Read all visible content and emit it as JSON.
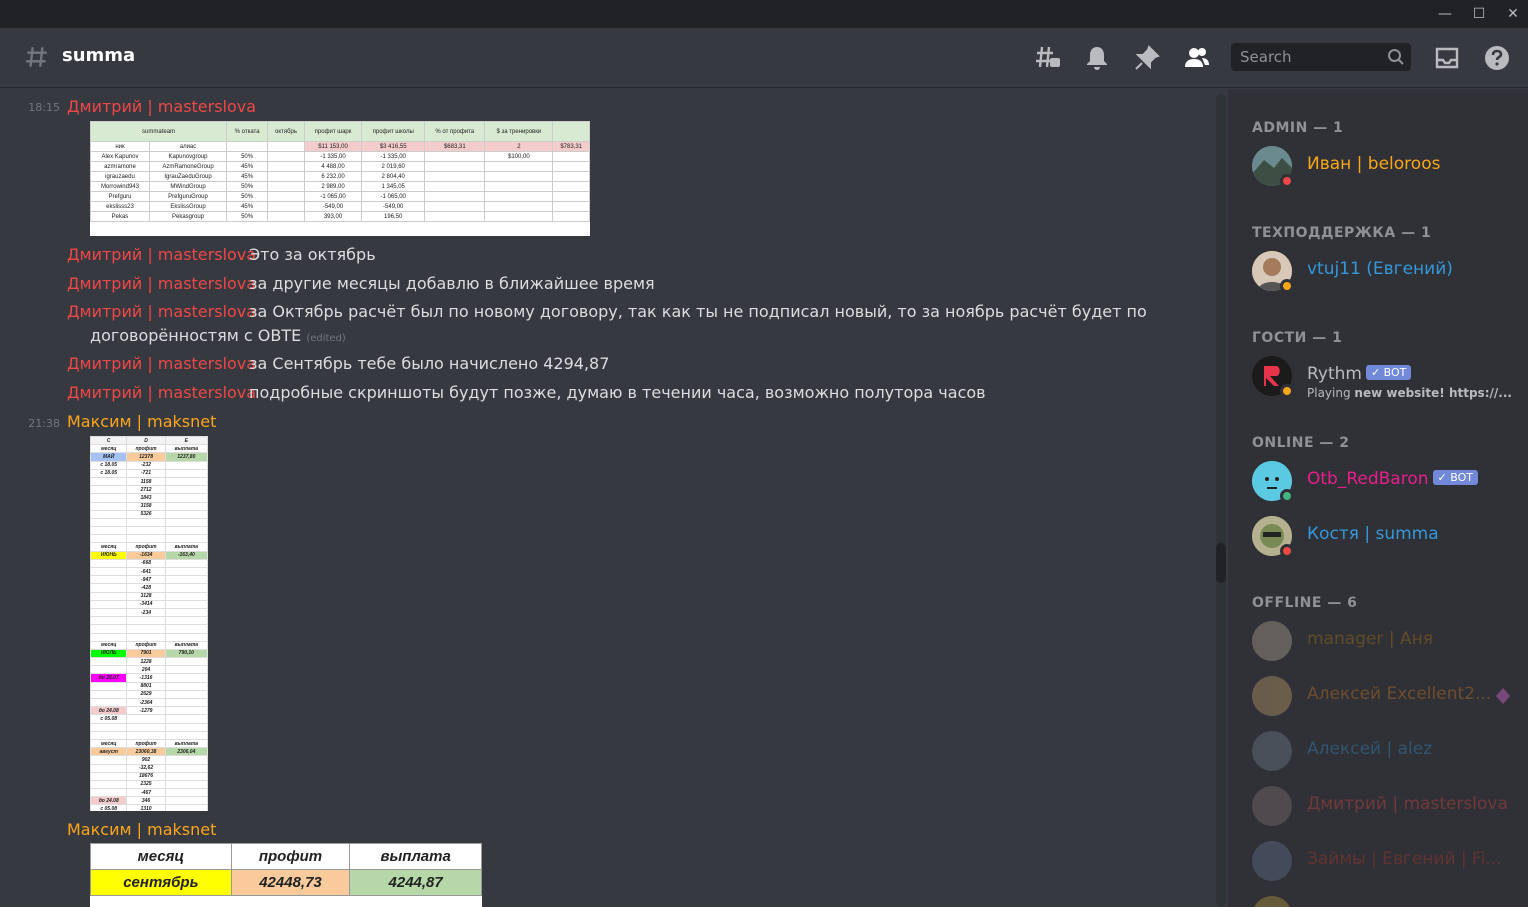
{
  "window": {
    "minimize": "—",
    "maximize": "☐",
    "close": "✕"
  },
  "channel": {
    "name": "summa"
  },
  "header": {
    "search_placeholder": "Search"
  },
  "messages": [
    {
      "time": "18:15",
      "author": "Дмитрий | masterslova"
    },
    {
      "author": "Дмитрий | masterslova",
      "text": "Это за октябрь"
    },
    {
      "author": "Дмитрий | masterslova",
      "text": "за другие месяцы добавлю  в ближайшее время"
    },
    {
      "author": "Дмитрий | masterslova",
      "text": "за Октябрь  расчёт был по новому договору, так как ты не подписал новый, то  за ноябрь расчёт будет по",
      "text2": "договорённостям с ОВТЕ",
      "edited": "(edited)"
    },
    {
      "author": "Дмитрий | masterslova",
      "text": "за Сентябрь тебе было начислено 4294,87"
    },
    {
      "author": "Дмитрий | masterslova",
      "text": "подробные скриншоты будут позже, думаю  в течении часа, возможно полутора часов"
    },
    {
      "time": "21:38",
      "author": "Максим | maksnet"
    },
    {
      "author": "Максим | maksnet"
    }
  ],
  "sheet1": {
    "header": [
      "summateam",
      "% отката",
      "октябрь",
      "профит шарк",
      "профит школы",
      "% от профита",
      "$ за тренировки",
      ""
    ],
    "sub": [
      "ник",
      "алиас",
      "",
      "",
      "$11 153,00",
      "$3 416,55",
      "$683,31",
      "2",
      "$783,31"
    ],
    "rows": [
      [
        "Alex Kapunov",
        "Kapunovgroup",
        "50%",
        "",
        "-1 335,00",
        "-1 335,00",
        "",
        "$100,00",
        ""
      ],
      [
        "azmramone",
        "AzmRamoneGroup",
        "45%",
        "",
        "4 488,00",
        "2 019,60",
        "",
        "",
        ""
      ],
      [
        "igrauzaedu",
        "IgrauZaeduGroup",
        "45%",
        "",
        "6 232,00",
        "2 804,40",
        "",
        "",
        ""
      ],
      [
        "Morrowind943",
        "MWindGroup",
        "50%",
        "",
        "2 989,00",
        "1 345,05",
        "",
        "",
        ""
      ],
      [
        "Prefguru",
        "PrefguruGroup",
        "50%",
        "",
        "-1 065,00",
        "-1 065,00",
        "",
        "",
        ""
      ],
      [
        "ekslisss23",
        "EkslissGroup",
        "45%",
        "",
        "-549,00",
        "-549,00",
        "",
        "",
        ""
      ],
      [
        "Pekas",
        "Pekasgroup",
        "50%",
        "",
        "393,00",
        "196,50",
        "",
        "",
        ""
      ]
    ]
  },
  "sheet2": {
    "rows": [
      [
        "C",
        "D",
        "E"
      ],
      [
        "месяц",
        "профит",
        "выплата"
      ],
      [
        "МАЙ",
        "12378",
        "1237,80"
      ],
      [
        "с 18.05",
        "-232",
        ""
      ],
      [
        "с 18.05",
        "-721",
        ""
      ],
      [
        "",
        "1158",
        ""
      ],
      [
        "",
        "2712",
        ""
      ],
      [
        "",
        "1843",
        ""
      ],
      [
        "",
        "3158",
        ""
      ],
      [
        "",
        "5326",
        ""
      ],
      [
        "",
        "",
        ""
      ],
      [
        "",
        "",
        ""
      ],
      [
        "",
        "",
        ""
      ],
      [
        "месяц",
        "профит",
        "выплата"
      ],
      [
        "ИЮНЬ",
        "-1634",
        "-163,40"
      ],
      [
        "",
        "-668",
        ""
      ],
      [
        "",
        "-641",
        ""
      ],
      [
        "",
        "-947",
        ""
      ],
      [
        "",
        "-428",
        ""
      ],
      [
        "",
        "3128",
        ""
      ],
      [
        "",
        "-3414",
        ""
      ],
      [
        "",
        "-234",
        ""
      ],
      [
        "",
        "",
        ""
      ],
      [
        "",
        "",
        ""
      ],
      [
        "",
        "",
        ""
      ],
      [
        "месяц",
        "профит",
        "выплата"
      ],
      [
        "ИЮЛЬ",
        "7901",
        "790,10"
      ],
      [
        "",
        "1228",
        ""
      ],
      [
        "",
        "204",
        ""
      ],
      [
        "до 26.07",
        "-1316",
        ""
      ],
      [
        "",
        "8801",
        ""
      ],
      [
        "",
        "2629",
        ""
      ],
      [
        "",
        "-2364",
        ""
      ],
      [
        "до 24.08",
        "-1279",
        ""
      ],
      [
        "с 05.08",
        "",
        ""
      ],
      [
        "",
        "",
        ""
      ],
      [
        "",
        "",
        ""
      ],
      [
        "месяц",
        "профит",
        "выплата"
      ],
      [
        "август",
        "23060,38",
        "2306,04"
      ],
      [
        "",
        "902",
        ""
      ],
      [
        "",
        "-32,62",
        ""
      ],
      [
        "",
        "18676",
        ""
      ],
      [
        "",
        "2325",
        ""
      ],
      [
        "",
        "-467",
        ""
      ],
      [
        "до 24.08",
        "346",
        ""
      ],
      [
        "с 05.08",
        "1310",
        ""
      ],
      [
        "с 01.09",
        "",
        ""
      ],
      [
        "",
        "",
        ""
      ]
    ]
  },
  "sheet3": {
    "headers": [
      "месяц",
      "профит",
      "выплата"
    ],
    "row": [
      "сентябрь",
      "42448,73",
      "4244,87"
    ]
  },
  "members": {
    "sections": [
      {
        "title": "ADMIN — 1"
      },
      {
        "title": "ТЕХПОДДЕРЖКА — 1"
      },
      {
        "title": "ГОСТИ — 1"
      },
      {
        "title": "ONLINE — 2"
      },
      {
        "title": "OFFLINE — 6"
      }
    ],
    "list": [
      {
        "name": "Иван | beloroos",
        "color": "#faa61a",
        "status": "#f04747"
      },
      {
        "name": "vtuj11 (Евгений)",
        "color": "#3498db",
        "status": "#faa61a"
      },
      {
        "name": "Rythm",
        "color": "#b9bbbe",
        "bot": "✓ BOT",
        "activity_prefix": "Playing ",
        "activity": "new website! https://...",
        "status": "#faa61a"
      },
      {
        "name": "Otb_RedBaron",
        "color": "#e91e8c",
        "bot": "✓ BOT",
        "status": "#43b581"
      },
      {
        "name": "Костя | summa",
        "color": "#3498db",
        "status": "#f04747"
      },
      {
        "name": "manager | Аня",
        "color": "#c27c0e"
      },
      {
        "name": "Алексей Excellent2...",
        "color": "#e67e22"
      },
      {
        "name": "Алексей | alez",
        "color": "#3498db"
      },
      {
        "name": "Дмитрий | masterslova",
        "color": "#f04747"
      },
      {
        "name": "Займы | Евгений | Fi...",
        "color": "#c0392b"
      }
    ]
  }
}
